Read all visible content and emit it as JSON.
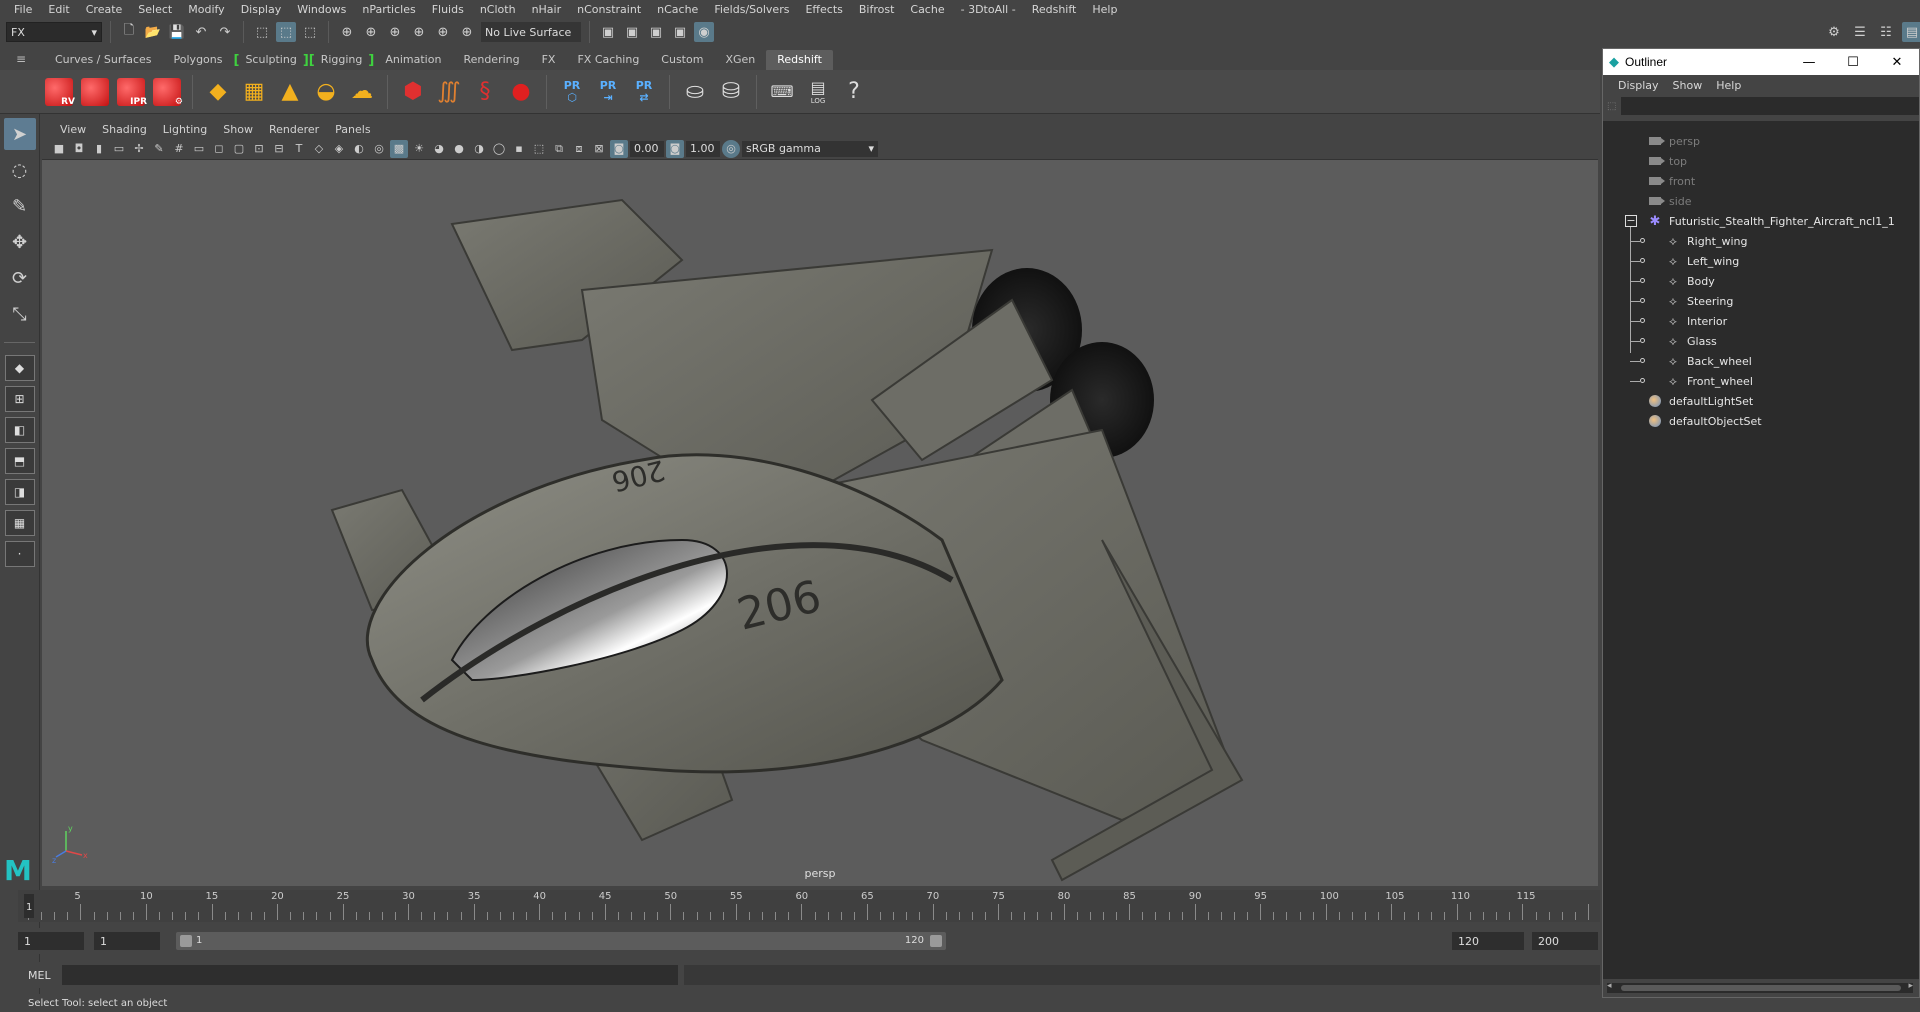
{
  "menubar": [
    "File",
    "Edit",
    "Create",
    "Select",
    "Modify",
    "Display",
    "Windows",
    "nParticles",
    "Fluids",
    "nCloth",
    "nHair",
    "nConstraint",
    "nCache",
    "Fields/Solvers",
    "Effects",
    "Bifrost",
    "Cache",
    "- 3DtoAll -",
    "Redshift",
    "Help"
  ],
  "statusline": {
    "mode": "FX",
    "live_surface": "No Live Surface"
  },
  "shelf_tabs": [
    "Curves / Surfaces",
    "Polygons",
    "Sculpting",
    "Rigging",
    "Animation",
    "Rendering",
    "FX",
    "FX Caching",
    "Custom",
    "XGen",
    "Redshift"
  ],
  "shelf_active_tab": "Redshift",
  "shelf_icon_labels": {
    "rv": "RV",
    "ipr": "IPR",
    "pr": "PR",
    "log": "LOG"
  },
  "panel_menu": [
    "View",
    "Shading",
    "Lighting",
    "Show",
    "Renderer",
    "Panels"
  ],
  "panel_toolbar": {
    "exposure": "0.00",
    "gamma": "1.00",
    "color_space": "sRGB gamma"
  },
  "viewport": {
    "camera_label": "persp",
    "hull_number": "206",
    "axis_y": "y",
    "axis_x": "x",
    "axis_z": "z"
  },
  "timeslider": {
    "ticks": [
      "1",
      "5",
      "10",
      "15",
      "20",
      "25",
      "30",
      "35",
      "40",
      "45",
      "50",
      "55",
      "60",
      "65",
      "70",
      "75",
      "80",
      "85",
      "90",
      "95",
      "100",
      "105",
      "110",
      "115"
    ],
    "current_frame": "1"
  },
  "range": {
    "start": "1",
    "playback_start": "1",
    "bar_start": "1",
    "bar_end": "120",
    "playback_end": "120",
    "end": "200"
  },
  "cmdline": {
    "label": "MEL"
  },
  "helpline": "Select Tool: select an object",
  "outliner": {
    "title": "Outliner",
    "menu": [
      "Display",
      "Show",
      "Help"
    ],
    "cameras": [
      "persp",
      "top",
      "front",
      "side"
    ],
    "group": "Futuristic_Stealth_Fighter_Aircraft_ncl1_1",
    "children": [
      "Right_wing",
      "Left_wing",
      "Body",
      "Steering",
      "Interior",
      "Glass",
      "Back_wheel",
      "Front_wheel"
    ],
    "sets": [
      "defaultLightSet",
      "defaultObjectSet"
    ]
  },
  "colors": {
    "ui_bg": "#444444",
    "viewport_bg": "#5c5c5c",
    "outliner_bg": "#2b2b2b",
    "active_tool": "#5e7c92",
    "redshift_red": "#d21a1a",
    "shelf_bracket_green": "#3fd13f"
  }
}
